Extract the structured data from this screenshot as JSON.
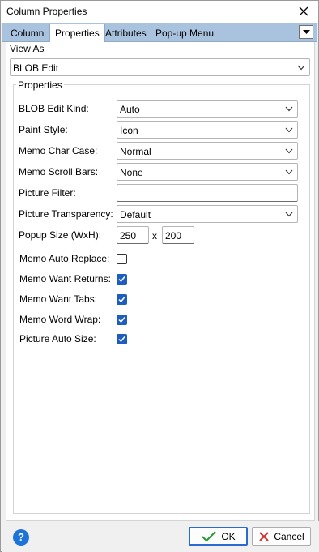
{
  "window": {
    "title": "Column Properties"
  },
  "tabs": [
    {
      "label": "Column"
    },
    {
      "label": "Properties",
      "active": true
    },
    {
      "label": "Attributes"
    },
    {
      "label": "Pop-up Menu"
    }
  ],
  "view_as": {
    "label": "View As",
    "value": "BLOB Edit"
  },
  "group": {
    "title": "Properties"
  },
  "fields": {
    "blob_edit_kind": {
      "label": "BLOB Edit Kind:",
      "value": "Auto"
    },
    "paint_style": {
      "label": "Paint Style:",
      "value": "Icon"
    },
    "memo_char_case": {
      "label": "Memo Char Case:",
      "value": "Normal"
    },
    "memo_scroll_bars": {
      "label": "Memo Scroll Bars:",
      "value": "None"
    },
    "picture_filter": {
      "label": "Picture Filter:",
      "value": ""
    },
    "picture_transparency": {
      "label": "Picture Transparency:",
      "value": "Default"
    },
    "popup_size": {
      "label": "Popup Size (WxH):",
      "width": "250",
      "sep": "x",
      "height": "200"
    }
  },
  "checks": {
    "memo_auto_replace": {
      "label": "Memo Auto Replace:",
      "checked": false
    },
    "memo_want_returns": {
      "label": "Memo Want Returns:",
      "checked": true
    },
    "memo_want_tabs": {
      "label": "Memo Want Tabs:",
      "checked": true
    },
    "memo_word_wrap": {
      "label": "Memo Word Wrap:",
      "checked": true
    },
    "picture_auto_size": {
      "label": "Picture Auto Size:",
      "checked": true
    }
  },
  "footer": {
    "help": "?",
    "ok_label": "OK",
    "cancel_label": "Cancel"
  },
  "colors": {
    "accent": "#1d5dbf",
    "tabbar": "#a9c3df",
    "ok_check": "#2e9b3a",
    "cancel_x": "#d32f2f"
  }
}
